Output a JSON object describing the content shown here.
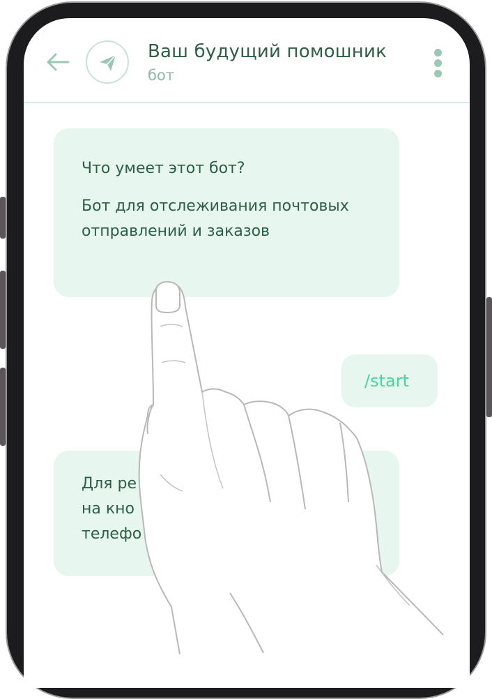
{
  "colors": {
    "accent": "#2e5e48",
    "muted": "#8fb7a6",
    "bubble": "#e7f7ef",
    "command": "#45d69a",
    "divider": "#d7ece3"
  },
  "header": {
    "back_icon": "arrow-left-icon",
    "avatar_icon": "paper-plane-icon",
    "title": "Ваш будущий помошник",
    "subtitle": "бот",
    "menu_icon": "vertical-dots-icon"
  },
  "messages": [
    {
      "type": "incoming",
      "heading": "Что умеет этот бот?",
      "lines": [
        "Бот для отслеживания почтовых",
        "отправлений и заказов"
      ]
    },
    {
      "type": "outgoing",
      "text": "/start"
    },
    {
      "type": "incoming",
      "lines": [
        "Для ре",
        "на кно",
        "телефо"
      ]
    }
  ]
}
